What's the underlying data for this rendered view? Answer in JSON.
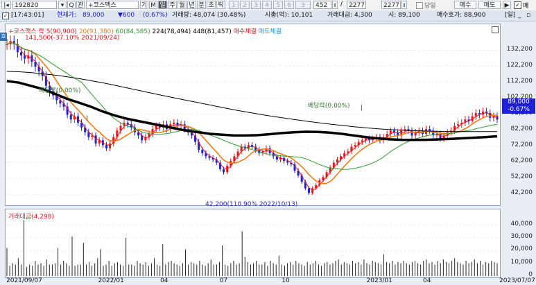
{
  "toolbar": {
    "code": "192820",
    "name": "+코스맥스",
    "periods": [
      "기",
      "M",
      "일",
      "주",
      "월",
      "년",
      "분",
      "초",
      "틱"
    ],
    "numbers": [
      "1",
      "2",
      "3",
      "4",
      "5",
      "6",
      "3"
    ],
    "count": "452",
    "slash": "/",
    "total": "2277",
    "total2": "2277",
    "check_label": "당일",
    "buy": "매수",
    "sell": "매도",
    "extra": "매"
  },
  "info": {
    "time": "[17:43:01]",
    "price_label": "현재가:",
    "price": "89,000",
    "change": "▼600",
    "change_pct": "(0.67%)",
    "volume": "거래량: 48,074 (30.48%)",
    "mktcap": "시총(억): 10,101",
    "amount": "거래대금: 4,300",
    "open": "시: 89,100",
    "bid": "매수호가: 88,900",
    "period_tag": "[일]"
  },
  "legend": {
    "name": "+코스맥스",
    "type": "락",
    "ma5": "5(90,900)",
    "ma20": "20(91,380)",
    "ma60": "60(84,585)",
    "ma224": "224(78,494)",
    "ma448": "448(81,457)",
    "buy_exec": "매수체결",
    "sell_exec": "매도체결",
    "vol_title": "거래대금(4,298)"
  },
  "annotations": {
    "high": "141,500(-37.10% 2021/09/24)",
    "low": "42,200(110.90% 2022/10/13)",
    "div1": "배당락(0.00%)",
    "div2": "배당락(0.00%)",
    "last_price": "89,000",
    "last_change": "-0.67%"
  },
  "colors": {
    "up": "#e8151c",
    "down": "#1f1fd6",
    "ma5": "#e8151c",
    "ma20": "#f07b14",
    "ma60": "#2f9a2f",
    "ma224": "#000000",
    "ma448": "#000000"
  },
  "chart_data": {
    "type": "line",
    "price_axis": {
      "ylim": [
        38000,
        145000
      ],
      "ticks": [
        132200,
        122200,
        112200,
        102200,
        92200,
        82200,
        72200,
        62200,
        52200,
        42200
      ]
    },
    "volume_axis": {
      "ylim": [
        0,
        48000
      ],
      "ticks": [
        40000,
        30000,
        20000,
        10000,
        0
      ]
    },
    "x_labels": [
      "2021/09/07",
      "2022/01",
      "04",
      "07",
      "10",
      "2023/01",
      "04",
      "2023/07/07"
    ],
    "x_label_index": [
      0,
      33,
      55,
      76,
      98,
      128,
      148,
      175
    ],
    "series": [
      {
        "name": "가격",
        "values": [
          136000,
          138000,
          136000,
          131000,
          129000,
          127000,
          129000,
          125000,
          122000,
          119000,
          116000,
          110000,
          106000,
          104000,
          101000,
          99000,
          97000,
          92000,
          89000,
          91000,
          87000,
          84000,
          81000,
          78000,
          79000,
          74000,
          76000,
          73000,
          71000,
          74000,
          78000,
          82000,
          85000,
          87000,
          86000,
          84000,
          81000,
          79000,
          76000,
          78000,
          80000,
          83000,
          85000,
          84000,
          86000,
          83000,
          86000,
          87000,
          85000,
          86000,
          83000,
          81000,
          79000,
          75000,
          70000,
          68000,
          66000,
          65000,
          64000,
          62000,
          58000,
          56000,
          60000,
          63000,
          66000,
          69000,
          72000,
          71000,
          73000,
          72000,
          70000,
          68000,
          69000,
          71000,
          68000,
          66000,
          64000,
          65000,
          63000,
          62000,
          61000,
          57000,
          54000,
          50000,
          46000,
          43000,
          46000,
          48000,
          51000,
          53000,
          56000,
          59000,
          62000,
          64000,
          66000,
          68000,
          69000,
          72000,
          73000,
          75000,
          76000,
          77000,
          76000,
          77000,
          78000,
          76000,
          78000,
          80000,
          82000,
          81000,
          79000,
          82000,
          83000,
          82000,
          79000,
          81000,
          82000,
          80000,
          83000,
          82000,
          79000,
          80000,
          77000,
          79000,
          81000,
          82000,
          85000,
          86000,
          87000,
          89000,
          88000,
          91000,
          93000,
          92000,
          94000,
          93000,
          90000,
          91000,
          89000
        ]
      },
      {
        "name": "224",
        "values": [
          113000,
          112000,
          110000,
          108000,
          105000,
          102000,
          99500,
          97000,
          94000,
          91500,
          89500,
          88000,
          86500,
          85000,
          83500,
          82000,
          81000,
          80000,
          79500,
          79000,
          79000,
          79200,
          79800,
          80500,
          81000,
          81300,
          81200,
          80800,
          80000,
          79000,
          78000,
          77200,
          76600,
          76300,
          76200,
          76300,
          76500,
          76800,
          77200,
          77600,
          78000,
          78500
        ]
      },
      {
        "name": "448",
        "values": [
          119000,
          118800,
          118300,
          117500,
          116700,
          115700,
          114600,
          113300,
          111900,
          110400,
          108800,
          107200,
          105600,
          104000,
          102500,
          101000,
          99500,
          98000,
          96500,
          95000,
          93700,
          92400,
          91200,
          90100,
          89000,
          88000,
          87000,
          86100,
          85300,
          84500,
          83800,
          83200,
          82700,
          82300,
          82000,
          81800,
          81600,
          81500,
          81450,
          81450,
          81450,
          81457
        ]
      }
    ],
    "volume": [
      22000,
      8000,
      10000,
      9000,
      14000,
      9000,
      44000,
      7000,
      9000,
      8000,
      12000,
      9000,
      10000,
      8000,
      13000,
      9000,
      9000,
      10000,
      22000,
      9000,
      12000,
      10000,
      8000,
      31000,
      8000,
      9000,
      9000,
      26000,
      9000,
      11000,
      8000,
      10000,
      14000,
      21000,
      8000,
      9000,
      12000,
      8000,
      10000,
      11000,
      9000,
      8000,
      30000,
      9000,
      9000,
      8000,
      12000,
      10000,
      9000,
      11000,
      8000,
      10000,
      14000,
      9000,
      8000,
      25000,
      9000,
      11000,
      12000,
      10000,
      9000,
      8000,
      10000,
      21000,
      9000,
      11000,
      10000,
      9000,
      12000,
      9000,
      8000,
      10000,
      13000,
      9000,
      9000,
      11000,
      24000,
      9000,
      8000,
      10000,
      12000,
      9000,
      10000,
      35000,
      15000,
      11000,
      9000,
      10000,
      12000,
      9000,
      9000,
      11000,
      8000,
      12000,
      10000,
      9000,
      16000,
      9000,
      8000,
      10000,
      11000,
      9000,
      12000,
      10000,
      9000,
      8000,
      11000,
      9000,
      10000,
      12000,
      9000,
      8000,
      10000,
      11000,
      9000,
      10000,
      12000,
      13000,
      9000,
      11000,
      10000,
      9000,
      12000,
      10000,
      11000,
      9000,
      13000,
      10000,
      9000,
      12000,
      11000,
      10000,
      9000,
      17000,
      11000,
      10000,
      12000,
      9000,
      11000,
      10000,
      12000,
      10000,
      9000,
      11000,
      12000,
      10000,
      9000,
      12000,
      13000,
      10000,
      11000,
      9000,
      12000,
      10000,
      13000,
      11000,
      10000,
      12000,
      14000,
      11000,
      10000,
      9000,
      12000,
      10000,
      11000,
      13000,
      10000,
      12000,
      9000,
      11000,
      10000,
      12000,
      11000,
      10000
    ]
  }
}
